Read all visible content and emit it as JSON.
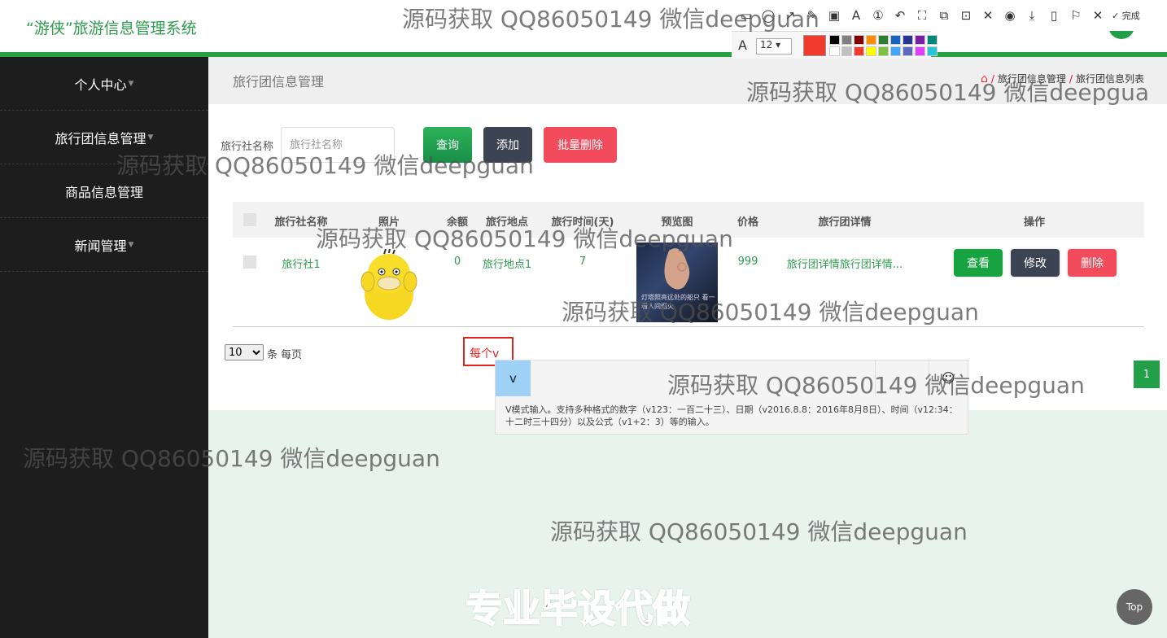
{
  "header": {
    "brand": "“游侠”旅游信息管理系统"
  },
  "sidebar": {
    "items": [
      {
        "label": "个人中心"
      },
      {
        "label": "旅行团信息管理"
      },
      {
        "label": "商品信息管理"
      },
      {
        "label": "新闻管理"
      }
    ]
  },
  "page": {
    "title": "旅行团信息管理",
    "breadcrumb": [
      "旅行团信息管理",
      "旅行团信息列表"
    ],
    "breadcrumb_sep": "/"
  },
  "search": {
    "label": "旅行社名称",
    "placeholder": "旅行社名称",
    "query_button": "查询",
    "add_button": "添加",
    "batch_delete_button": "批量删除"
  },
  "table": {
    "headers": [
      "旅行社名称",
      "照片",
      "余额",
      "旅行地点",
      "旅行时间(天)",
      "预览图",
      "价格",
      "旅行团详情",
      "操作"
    ],
    "rows": [
      {
        "agency": "旅行社1",
        "balance": "0",
        "location": "旅行地点1",
        "days": "7",
        "price": "999",
        "details": "旅行团详情旅行团详情...",
        "preview_caption": "灯塔照亮远处的船只 看一看人间烟火",
        "actions": {
          "view": "查看",
          "edit": "修改",
          "delete": "删除"
        }
      }
    ]
  },
  "pagination": {
    "page_size": "10",
    "page_size_options": [
      "10"
    ],
    "per_page_text": "条 每页",
    "current_page": "1"
  },
  "ime": {
    "input_text": "每个v",
    "candidate": "v",
    "smile_icon": "☺",
    "hint": "V模式输入。支持多种格式的数字（v123：一百二十三）、日期（v2016.8.8：2016年8月8日）、时间（v12:34：十二时三十四分）以及公式（v1+2：3）等的输入。"
  },
  "annotation_toolbar": {
    "tools": [
      "▭",
      "◯",
      "↗",
      "✎",
      "▣",
      "A",
      "①",
      "↶",
      "⛶",
      "⧉",
      "⊡",
      "✕",
      "◉",
      "⤓",
      "▯",
      "⚐",
      "✕"
    ],
    "done_label": "✓ 完成",
    "font_icon": "A",
    "font_size": "12 ▾",
    "current_color": "#f03a2e",
    "swatches": [
      "#000000",
      "#808080",
      "#800000",
      "#ff8c00",
      "#2e7d32",
      "#1565c0",
      "#283593",
      "#7b1fa2",
      "#00897b",
      "#ffffff",
      "#c0c0c0",
      "#f03a2e",
      "#ffff00",
      "#7cc142",
      "#42a5f5",
      "#5c6bc0",
      "#e040fb",
      "#26c6da"
    ]
  },
  "watermarks": [
    "源码获取 QQ86050149 微信deepguan",
    "源码获取 QQ86050149 微信deepgua",
    "源码获取 QQ86050149 微信deepguan",
    "源码获取 QQ86050149 微信deepguan",
    "源码获取 QQ86050149 微信deepguan",
    "源码获取 QQ86050149 微信deepguan",
    "源码获取 QQ86050149 微信deepguan",
    "源码获取 QQ86050149 微信deepguan"
  ],
  "banner": "专业毕设代做",
  "back_to_top": "Top",
  "colors": {
    "brand_green": "#24a244",
    "sidebar_bg": "#1c1d1c",
    "danger": "#f24b5c",
    "dark_btn": "#3c4454"
  }
}
